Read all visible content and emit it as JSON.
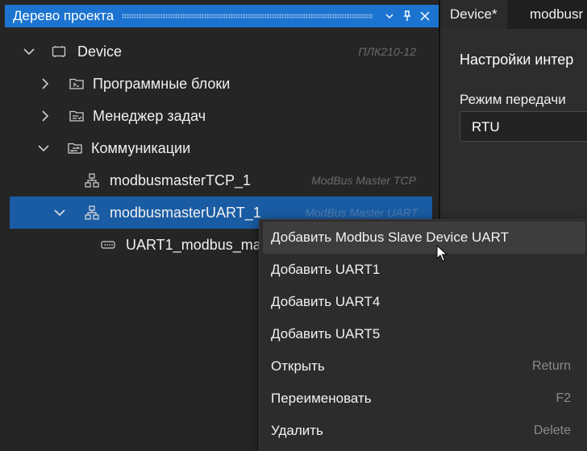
{
  "panel": {
    "title": "Дерево проекта",
    "buttons": {
      "pin_icon": "pin-icon",
      "close_icon": "close-icon"
    }
  },
  "tree": {
    "items": [
      {
        "label": "Device",
        "hint": "ПЛК210-12",
        "expanded": true,
        "icon": "device-icon"
      },
      {
        "label": "Программные блоки",
        "hint": "",
        "expanded": false,
        "icon": "program-folder-icon"
      },
      {
        "label": "Менеджер задач",
        "hint": "",
        "expanded": false,
        "icon": "task-folder-icon"
      },
      {
        "label": "Коммуникации",
        "hint": "",
        "expanded": true,
        "icon": "comm-folder-icon"
      },
      {
        "label": "modbusmasterTCP_1",
        "hint": "ModBus Master TCP",
        "icon": "network-icon"
      },
      {
        "label": "modbusmasterUART_1",
        "hint": "ModBus Master UART",
        "expanded": true,
        "selected": true,
        "icon": "network-icon"
      },
      {
        "label": "UART1_modbus_mast",
        "hint": "",
        "icon": "serial-port-icon"
      }
    ]
  },
  "doc": {
    "tabs": [
      "Device*",
      "modbusr"
    ],
    "title": "Настройки интер",
    "field_label": "Режим передачи",
    "field_value": "RTU"
  },
  "menu": {
    "items": [
      {
        "label": "Добавить Modbus Slave Device UART",
        "shortcut": ""
      },
      {
        "label": "Добавить UART1",
        "shortcut": ""
      },
      {
        "label": "Добавить UART4",
        "shortcut": ""
      },
      {
        "label": "Добавить UART5",
        "shortcut": ""
      },
      {
        "label": "Открыть",
        "shortcut": "Return"
      },
      {
        "label": "Переименовать",
        "shortcut": "F2"
      },
      {
        "label": "Удалить",
        "shortcut": "Delete"
      }
    ]
  },
  "colors": {
    "header_accent": "#1c74d0",
    "selection": "#1a5ca3",
    "menu_bg": "#2c2c2c"
  }
}
